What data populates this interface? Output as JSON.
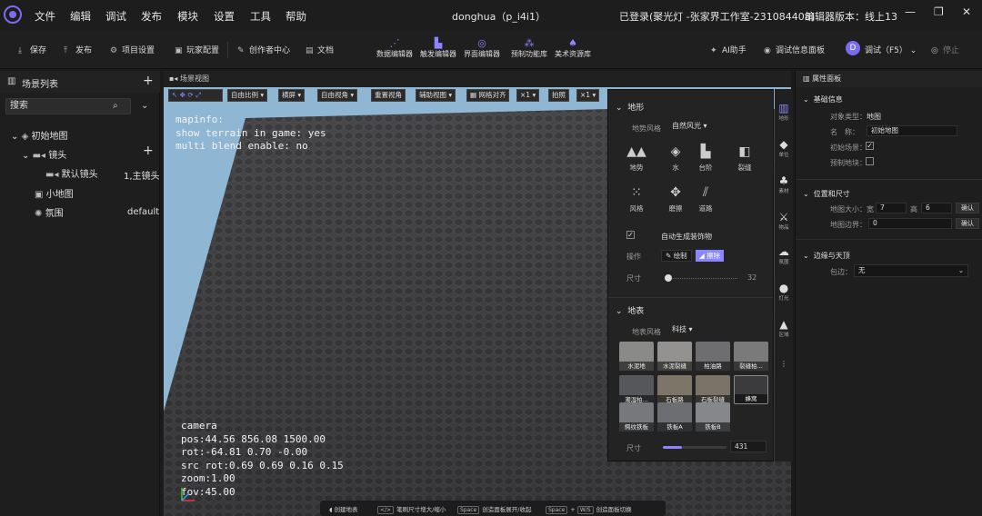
{
  "menubar": {
    "items": [
      "文件",
      "编辑",
      "调试",
      "发布",
      "模块",
      "设置",
      "工具",
      "帮助"
    ],
    "title": "donghua（p_i4i1）",
    "login": "已登录(聚光灯 -张家界工作室-231084408)",
    "version": "编辑器版本：线上13"
  },
  "toolbar": {
    "left": [
      "保存",
      "发布",
      "项目设置",
      "玩家配置",
      "创作者中心",
      "文档"
    ],
    "center": [
      "数据编辑器",
      "触发编辑器",
      "界面编辑器",
      "预制功能库",
      "美术资源库"
    ],
    "right": [
      "AI助手",
      "调试信息面板",
      "调试（F5）",
      "停止"
    ]
  },
  "left_panel": {
    "title": "场景列表",
    "search_placeholder": "搜索",
    "tree": {
      "root": "初始地图",
      "camera_group": "镜头",
      "default_camera": "默认镜头",
      "default_camera_tag": "1,主镜头",
      "minimap": "小地图",
      "atmosphere": "氛围",
      "atmosphere_tag": "default"
    }
  },
  "viewport": {
    "title": "场景视图",
    "tools": [
      "自由比例",
      "横屏",
      "自由视角",
      "重置视角",
      "辅助视图",
      "网格对齐",
      "×1",
      "拍照",
      "×1"
    ],
    "mapinfo_text": "mapinfo:\nshow terrain in game: yes\nmulti blend enable: no",
    "camera_text": "camera\npos:44.56 856.08 1500.00\nrot:-64.81 0.70 -0.00\nsrc rot:0.69 0.69 0.16 0.15\nzoom:1.00\nfov:45.00"
  },
  "statusbar": {
    "items": [
      {
        "key": "",
        "label": "创建地表"
      },
      {
        "key": "</>",
        "label": "笔刷尺寸增大/缩小"
      },
      {
        "key": "Space",
        "label": "创造面板展开/收起"
      },
      {
        "key": "Space",
        "key2": "W/S",
        "label": "创造面板切换"
      }
    ]
  },
  "terrain_panel": {
    "section_terrain": "地形",
    "terrain_style_label": "地势风格",
    "terrain_style_value": "自然风光",
    "tools": [
      {
        "icon": "terrain-icon",
        "label": "地势"
      },
      {
        "icon": "water-icon",
        "label": "水"
      },
      {
        "icon": "steps-icon",
        "label": "台阶"
      },
      {
        "icon": "crack-icon",
        "label": "裂缝"
      },
      {
        "icon": "style-icon",
        "label": "风格"
      },
      {
        "icon": "smooth-icon",
        "label": "磨擦"
      },
      {
        "icon": "road-icon",
        "label": "道路"
      }
    ],
    "auto_decor_label": "自动生成装饰物",
    "operation_label": "操作",
    "op_draw": "绘制",
    "op_erase": "擦除",
    "size_label": "尺寸",
    "size_value": "32",
    "section_surface": "地表",
    "surface_style_label": "地表风格",
    "surface_style_value": "科技",
    "textures": [
      "水泥地",
      "水泥裂缝",
      "柏油路",
      "裂缝柏...",
      "潮湿柏...",
      "石板路",
      "石板裂缝",
      "蜂窝",
      "鳄纹铁板",
      "铁板A",
      "铁板B"
    ],
    "surface_size_label": "尺寸",
    "surface_size_value": "431",
    "surface_size_fraction": 0.3
  },
  "icon_strip": [
    "地形",
    "单位",
    "素材",
    "物品",
    "氛围",
    "灯光",
    "区域"
  ],
  "right_panel": {
    "title": "属性面板",
    "basic_section": "基础信息",
    "object_type_label": "对象类型：",
    "object_type_value": "地图",
    "name_label": "名　称：",
    "name_value": "初始地图",
    "initial_scene_label": "初始场景：",
    "prefab_label": "预制地块：",
    "position_section": "位置和尺寸",
    "map_size_label": "地图大小：",
    "width_label": "宽",
    "width_value": "7",
    "height_label": "高",
    "height_value": "6",
    "confirm": "确认",
    "map_border_label": "地图边界：",
    "map_border_value": "0",
    "edge_section": "边缘与天顶",
    "surround_label": "包边：",
    "surround_value": "无"
  }
}
